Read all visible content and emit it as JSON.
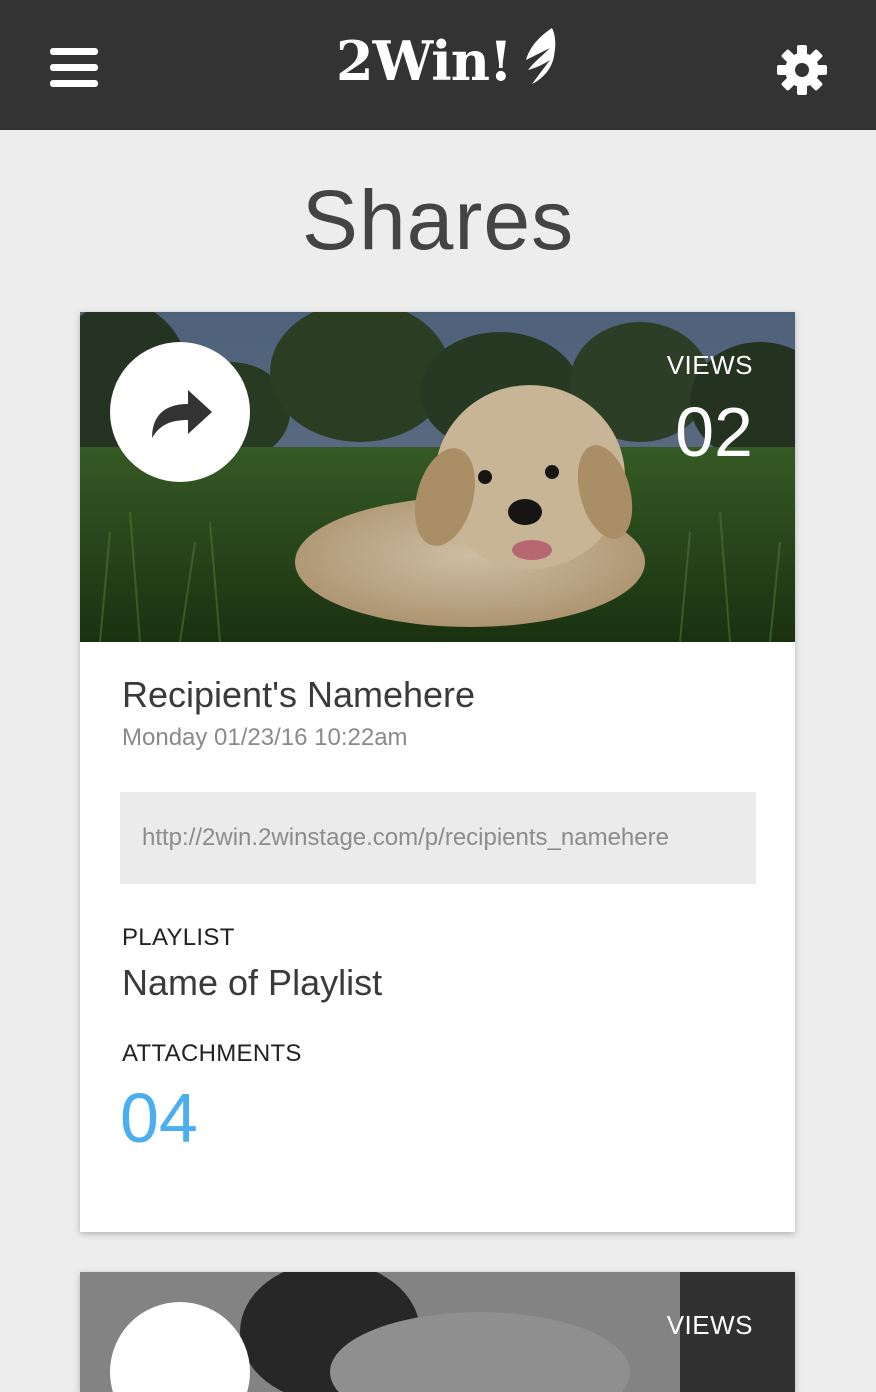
{
  "header": {
    "logo_text": "2Win!",
    "menu_icon": "hamburger-icon",
    "settings_icon": "gear-icon"
  },
  "page": {
    "title": "Shares"
  },
  "shares": [
    {
      "views_label": "VIEWS",
      "views_count": "02",
      "recipient_name": "Recipient's Namehere",
      "datetime": "Monday 01/23/16 10:22am",
      "share_url": "http://2win.2winstage.com/p/recipients_namehere",
      "playlist_label": "PLAYLIST",
      "playlist_name": "Name of Playlist",
      "attachments_label": "ATTACHMENTS",
      "attachments_count": "04",
      "thumbnail": "golden retriever puppy lying in grass"
    },
    {
      "views_label": "VIEWS",
      "thumbnail": "dark dog photo"
    }
  ],
  "colors": {
    "header_bg": "#333333",
    "page_bg": "#ededed",
    "accent": "#4baef0"
  }
}
